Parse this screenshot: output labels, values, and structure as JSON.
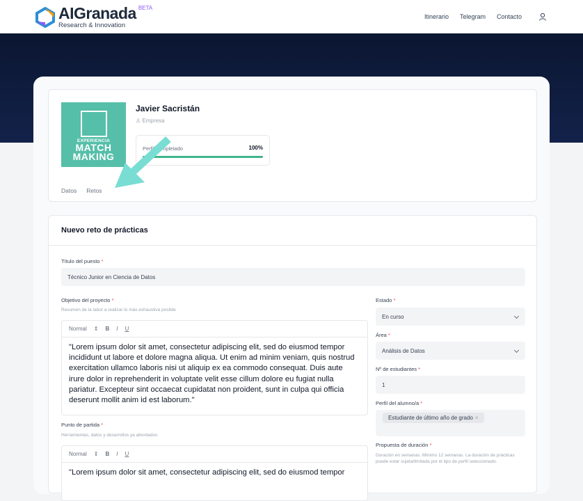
{
  "header": {
    "logo_main": "AIGranada",
    "logo_beta": "BETA",
    "logo_sub": "Research & Innovation",
    "nav": [
      "Itinerario",
      "Telegram",
      "Contacto"
    ]
  },
  "profile": {
    "avatar_line1": "EXPERIENCIA",
    "avatar_line2": "MATCH",
    "avatar_line3": "MAKING",
    "name": "Javier Sacristán",
    "role": "Empresa",
    "progress_label": "Perfil completado",
    "progress_value": "100%",
    "progress_fraction": 1.0,
    "tabs": [
      "Datos",
      "Retos"
    ]
  },
  "form": {
    "title": "Nuevo reto de prácticas",
    "puesto_label": "Título del puesto",
    "puesto_value": "Técnico Junior en Ciencia de Datos",
    "objetivo_label": "Objetivo del proyecto",
    "objetivo_hint": "Resumen de la labor a realizar lo más exhaustiva posible",
    "toolbar": {
      "style": "Normal",
      "arrows": "⇕",
      "bold": "B",
      "italic": "I",
      "underline": "U"
    },
    "objetivo_text": "\"Lorem ipsum dolor sit amet, consectetur adipiscing elit, sed do eiusmod tempor incididunt ut labore et dolore magna aliqua. Ut enim ad minim veniam, quis nostrud exercitation ullamco laboris nisi ut aliquip ex ea commodo consequat. Duis aute irure dolor in reprehenderit in voluptate velit esse cillum dolore eu fugiat nulla pariatur. Excepteur sint occaecat cupidatat non proident, sunt in culpa qui officia deserunt mollit anim id est laborum.\"",
    "partida_label": "Punto de partida",
    "partida_hint": "Herramientas, datos y desarrollos ya abordados",
    "partida_text": "\"Lorem ipsum dolor sit amet, consectetur adipiscing elit, sed do eiusmod tempor",
    "estado_label": "Estado",
    "estado_value": "En curso",
    "area_label": "Área",
    "area_value": "Análisis de Datos",
    "estudiantes_label": "Nº de estudiantes",
    "estudiantes_value": "1",
    "perfil_label": "Perfil del alumno/a",
    "perfil_chip": "Estudiante de último año de grado",
    "perfil_chip_remove": "×",
    "duracion_label": "Propuesta de duración",
    "duracion_hint": "Duración en semanas. Mínimo 12 semanas. La duración de prácticas puede estar sujeta/limitada por el tipo de perfil seleccionado.",
    "required_mark": "*"
  },
  "colors": {
    "accent": "#3fb58c",
    "avatar_bg": "#56bfa9",
    "arrow": "#79ddd3",
    "hero": "#0b1631"
  }
}
